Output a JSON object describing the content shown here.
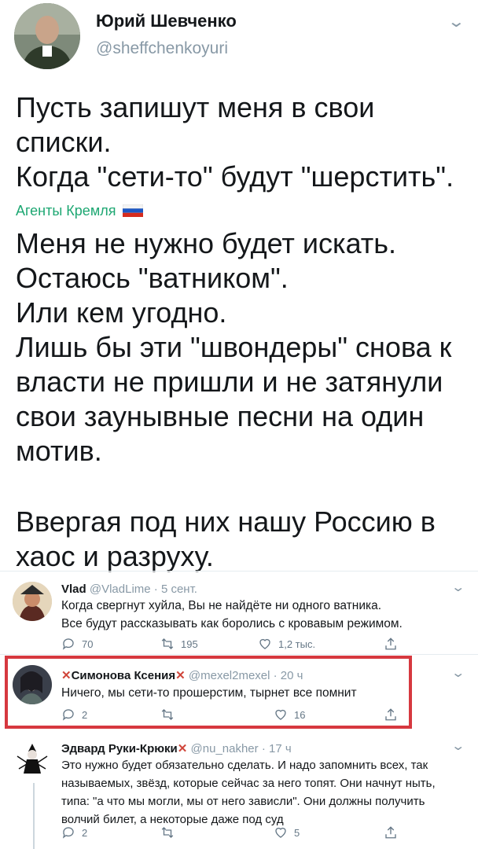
{
  "tweet": {
    "author_name": "Юрий Шевченко",
    "author_handle": "@sheffchenkoyuri",
    "text_part1": "Пусть запишут меня в свои\nсписки.\nКогда \"сети-то\" будут \"шерстить\".",
    "tag_label": "Агенты Кремля",
    "text_part2": "Меня не нужно будет искать.\nОстаюсь \"ватником\".\nИли кем угодно.\nЛишь бы эти \"швондеры\" снова к\nвласти не пришли и не затянули\nсвои заунывные песни на один\nмотив.",
    "text_part3": "Ввергая под них нашу Россию в\nхаос и разруху."
  },
  "replies": [
    {
      "name": "Vlad",
      "handle": "@VladLime",
      "time": "· 5 сент.",
      "text": "Когда свергнут хуйла, Вы не найдёте ни одного ватника.\nВсе будут рассказывать как боролись с кровавым режимом.",
      "replies": "70",
      "retweets": "195",
      "likes": "1,2 тыс."
    },
    {
      "name": "Симонова Ксения",
      "handle": "@mexel2mexel",
      "time": "· 20 ч",
      "text": "Ничего, мы сети-то прошерстим, тырнет все помнит",
      "replies": "2",
      "retweets": "",
      "likes": "16"
    },
    {
      "name": "Эдвард Руки-Крюки",
      "handle": "@nu_nakher",
      "time": "· 17 ч",
      "text": "Это нужно будет обязательно сделать. И надо запомнить всех, так\nназываемых, звёзд, которые сейчас за него топят. Они начнут ныть,\nтипа: \"а что мы могли, мы от него зависли\". Они должны получить\nволчий билет, а некоторые даже под суд",
      "replies": "2",
      "retweets": "",
      "likes": "5"
    }
  ],
  "colors": {
    "tag": "#1da772",
    "highlight": "#d6383f",
    "muted": "#8899a6"
  }
}
